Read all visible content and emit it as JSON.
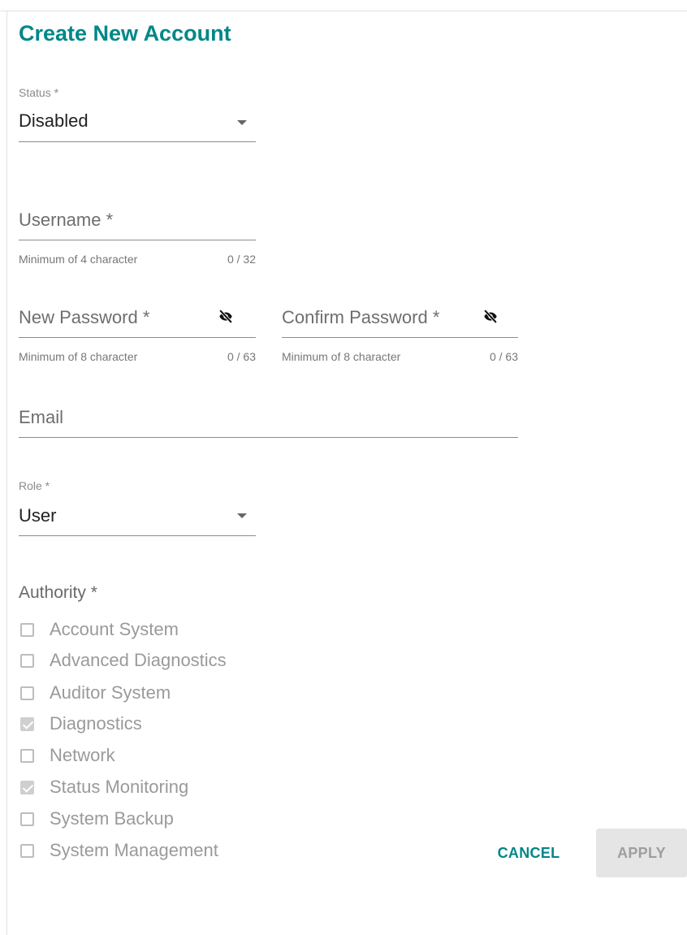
{
  "dialog": {
    "title": "Create New Account"
  },
  "status": {
    "label": "Status *",
    "value": "Disabled"
  },
  "username": {
    "placeholder": "Username *",
    "hint": "Minimum of 4 character",
    "counter": "0 / 32"
  },
  "new_password": {
    "placeholder": "New Password *",
    "hint": "Minimum of 8 character",
    "counter": "0 / 63",
    "icon": "visibility-off-icon"
  },
  "confirm_password": {
    "placeholder": "Confirm Password *",
    "hint": "Minimum of 8 character",
    "counter": "0 / 63",
    "icon": "visibility-off-icon"
  },
  "email": {
    "placeholder": "Email"
  },
  "role": {
    "label": "Role *",
    "value": "User"
  },
  "authority": {
    "label": "Authority *",
    "items": [
      {
        "label": "Account System",
        "checked": false
      },
      {
        "label": "Advanced Diagnostics",
        "checked": false
      },
      {
        "label": "Auditor System",
        "checked": false
      },
      {
        "label": "Diagnostics",
        "checked": true
      },
      {
        "label": "Network",
        "checked": false
      },
      {
        "label": "Status Monitoring",
        "checked": true
      },
      {
        "label": "System Backup",
        "checked": false
      },
      {
        "label": "System Management",
        "checked": false
      }
    ]
  },
  "actions": {
    "cancel_label": "CANCEL",
    "apply_label": "APPLY"
  },
  "colors": {
    "accent": "#008787",
    "disabled_text": "#9a9a9a",
    "disabled_button_bg": "#e5e5e5"
  }
}
